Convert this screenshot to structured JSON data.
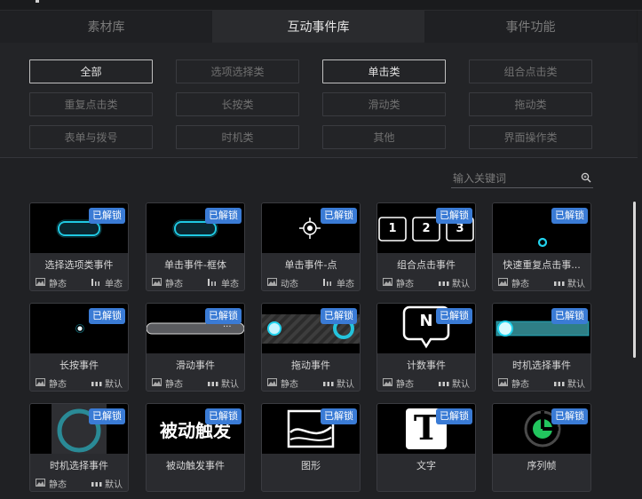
{
  "tabs": [
    "素材库",
    "互动事件库",
    "事件功能"
  ],
  "active_tab": 1,
  "filters": [
    [
      "全部",
      "选项选择类",
      "单击类",
      "组合点击类"
    ],
    [
      "重复点击类",
      "长按类",
      "滑动类",
      "拖动类"
    ],
    [
      "表单与拨号",
      "时机类",
      "其他",
      "界面操作类"
    ]
  ],
  "search": {
    "placeholder": "输入关键词"
  },
  "colors": {
    "accent": "#3a7bd5",
    "cyan": "#22d3ee",
    "green": "#22c55e"
  },
  "badge_label": "已解锁",
  "cards": [
    {
      "name": "选择选项类事件",
      "type": "静态",
      "mode": "单态",
      "thumb": "pill-glow"
    },
    {
      "name": "单击事件-框体",
      "type": "静态",
      "mode": "单态",
      "thumb": "pill-glow"
    },
    {
      "name": "单击事件-点",
      "type": "动态",
      "mode": "单态",
      "thumb": "crosshair"
    },
    {
      "name": "组合点击事件",
      "type": "静态",
      "mode": "默认",
      "thumb": "numbers",
      "numbers": [
        "1",
        "2",
        "3"
      ]
    },
    {
      "name": "快速重复点击事...",
      "type": "静态",
      "mode": "默认",
      "thumb": "dot-cyan"
    },
    {
      "name": "长按事件",
      "type": "静态",
      "mode": "默认",
      "thumb": "dot-white"
    },
    {
      "name": "滑动事件",
      "type": "静态",
      "mode": "默认",
      "thumb": "slider",
      "slider_text": "..."
    },
    {
      "name": "拖动事件",
      "type": "静态",
      "mode": "默认",
      "thumb": "drag"
    },
    {
      "name": "计数事件",
      "type": "静态",
      "mode": "默认",
      "thumb": "count",
      "count_letter": "N"
    },
    {
      "name": "时机选择事件",
      "type": "静态",
      "mode": "默认",
      "thumb": "timing"
    },
    {
      "name": "时机选择事件",
      "type": "静态",
      "mode": "默认",
      "thumb": "ring"
    },
    {
      "name": "被动触发事件",
      "type": "",
      "mode": "",
      "thumb": "passive-text",
      "thumb_text": "被动触发"
    },
    {
      "name": "图形",
      "type": "",
      "mode": "",
      "thumb": "shape"
    },
    {
      "name": "文字",
      "type": "",
      "mode": "",
      "thumb": "text",
      "thumb_text": "T"
    },
    {
      "name": "序列帧",
      "type": "",
      "mode": "",
      "thumb": "sequence"
    }
  ]
}
